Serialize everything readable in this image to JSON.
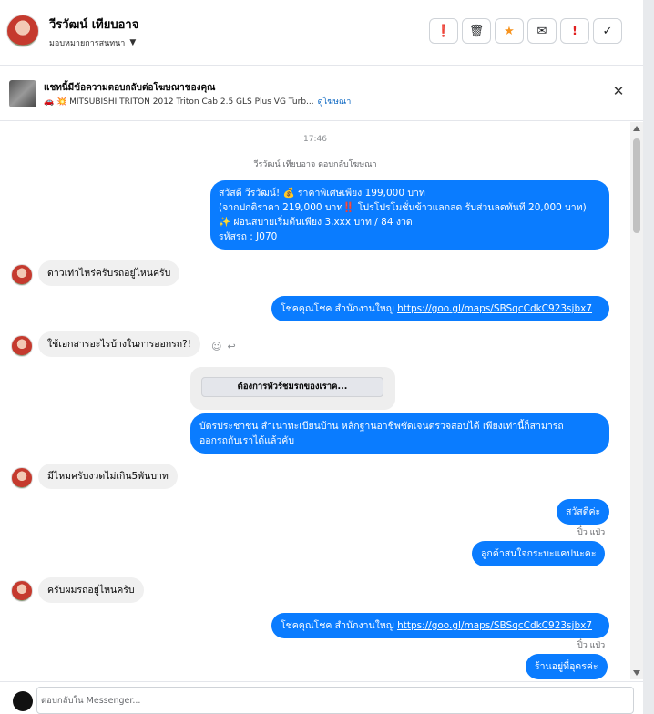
{
  "header": {
    "contact_name": "วีรวัฒน์ เทียบอาจ",
    "assign_label": "มอบหมายการสนทนา",
    "actions": [
      {
        "icon": "alert-circle-icon",
        "glyph": "❗"
      },
      {
        "icon": "trash-icon",
        "glyph": "🗑"
      },
      {
        "icon": "star-icon",
        "glyph": "★"
      },
      {
        "icon": "mark-unread-icon",
        "glyph": "✉"
      },
      {
        "icon": "exclamation-icon",
        "glyph": "!"
      },
      {
        "icon": "check-icon",
        "glyph": "✓"
      }
    ]
  },
  "ad_banner": {
    "title": "แชทนี้มีข้อความตอบกลับต่อโฆษณาของคุณ",
    "ad_text": "🚗 💥 MITSUBISHI TRITON 2012 Triton Cab 2.5 GLS Plus VG Turb...",
    "view_ad_link": "ดูโฆษณา",
    "close_glyph": "✕"
  },
  "chat": {
    "time": "17:46",
    "reply_note": "วีรวัฒน์ เทียบอาจ ตอบกลับโฆษณา",
    "promo": {
      "line1": "สวัสดี วีรวัฒน์! 💰 ราคาพิเศษเพียง 199,000 บาท",
      "line2": "(จากปกติราคา 219,000 บาท‼️ โปรโปรโมชั่นข้าวแลกลด รับส่วนลดทันที 20,000 บาท)",
      "line3": "✨ ผ่อนสบายเริ่มต้นเพียง 3,xxx บาท / 84 งวด",
      "line4": "รหัสรถ : J070"
    },
    "msg_in_1": "ดาวเท่าไหร่ครับรถอยู่ไหนครับ",
    "msg_out_location_1_text": "โชคคุณโชค สำนักงานใหญ่ ",
    "msg_out_location_1_link": "https://goo.gl/maps/SBSqcCdkC923sjbx7",
    "msg_in_2": "ใช้เอกสารอะไรบ้างในการออกรถ?!",
    "react_smile": "☺",
    "react_reply": "↩",
    "quick_reply_button": "ต้องการทัวร์ชมรถของเราค...",
    "msg_out_docs_line1": "บัตรประชาชน สำเนาทะเบียนบ้าน หลักฐานอาชีพชัดเจนตรวจสอบได้ เพียงเท่านี้ก็สามารถ",
    "msg_out_docs_line2": "ออกรถกับเราได้แล้วคับ",
    "msg_in_3": "มีไหมครับงวดไม่เกิน5พันบาท",
    "msg_out_hello": "สวัสดีค่ะ",
    "sender_1": "ปิ๋ว แป๋ว",
    "msg_out_interest": "ลูกค้าสนใจกระบะแคปนะคะ",
    "msg_in_4": "ครับผมรถอยู่ไหนครับ",
    "msg_out_location_2_text": "โชคคุณโชค สำนักงานใหญ่ ",
    "msg_out_location_2_link": "https://goo.gl/maps/SBSqcCdkC923sjbx7",
    "sender_2": "ปิ๋ว แป๋ว",
    "msg_out_shop": "ร้านอยู่ที่อุดรค่ะ"
  },
  "composer": {
    "placeholder": "ตอบกลับใน Messenger..."
  }
}
